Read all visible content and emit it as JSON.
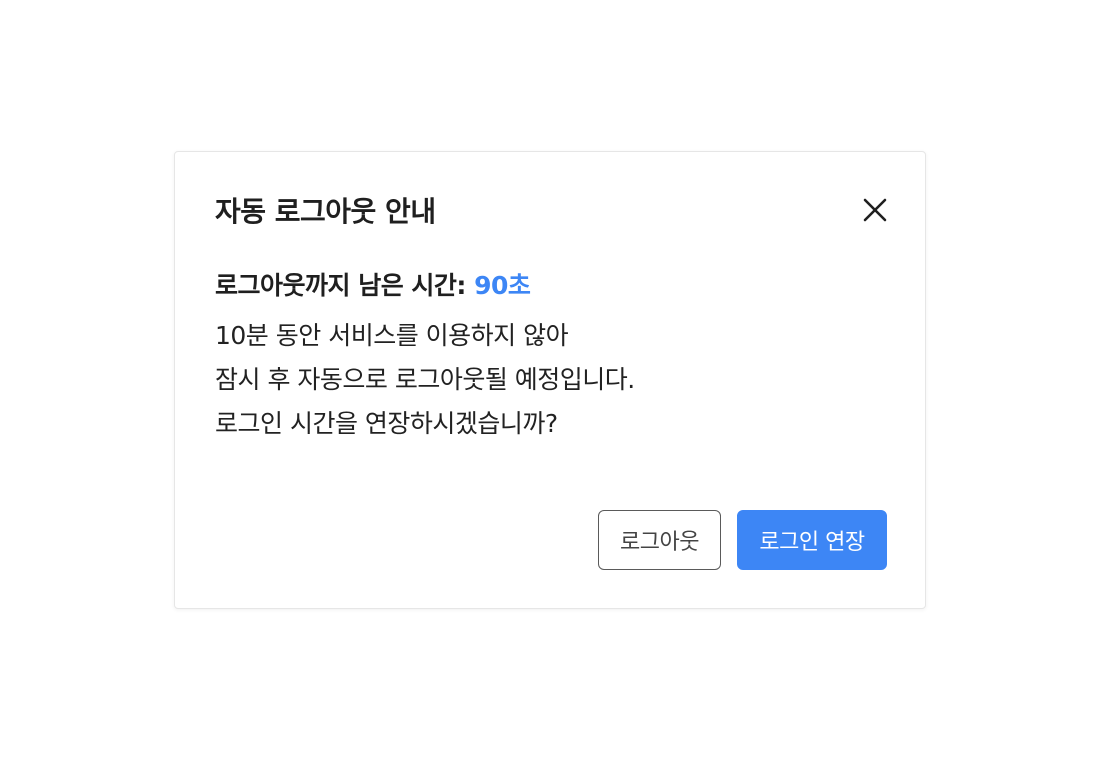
{
  "dialog": {
    "title": "자동 로그아웃 안내",
    "countdown_label": "로그아웃까지 남은 시간: ",
    "countdown_value": "90초",
    "message_lines": [
      "10분 동안 서비스를 이용하지 않아",
      "잠시 후 자동으로 로그아웃될 예정입니다.",
      "로그인 시간을 연장하시겠습니까?"
    ],
    "buttons": {
      "logout_label": "로그아웃",
      "extend_label": "로그인 연장"
    },
    "close_icon": "close-icon"
  },
  "colors": {
    "accent": "#3d86f5",
    "text": "#1f1f1f",
    "border": "#e6e6e6"
  }
}
